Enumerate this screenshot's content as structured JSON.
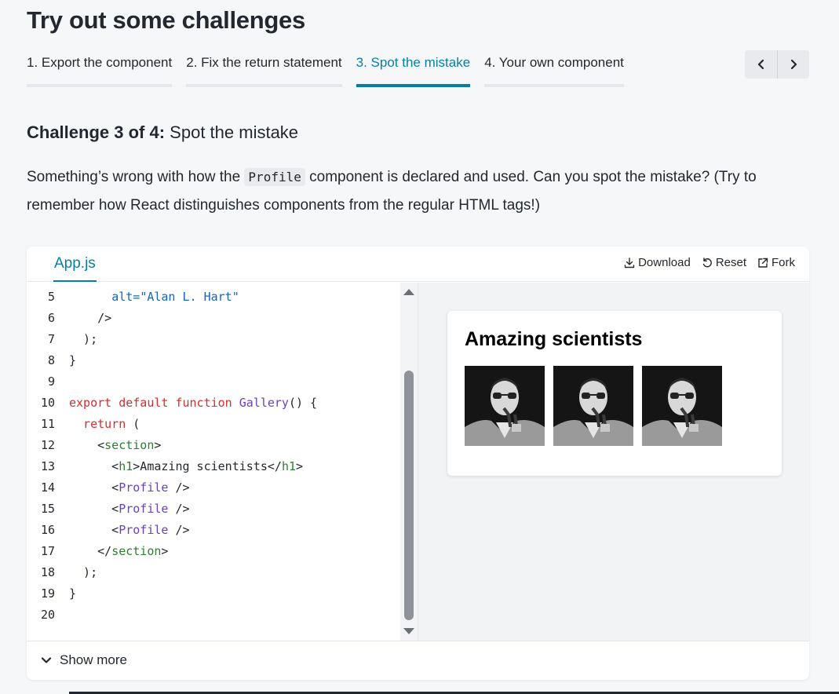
{
  "page": {
    "title": "Try out some challenges"
  },
  "tabs": [
    {
      "label": "1. Export the component",
      "active": false
    },
    {
      "label": "2. Fix the return statement",
      "active": false
    },
    {
      "label": "3. Spot the mistake",
      "active": true
    },
    {
      "label": "4. Your own component",
      "active": false
    }
  ],
  "nav": {
    "prev_icon": "chevron-left-icon",
    "next_icon": "chevron-right-icon"
  },
  "challenge": {
    "counter": "Challenge 3 of 4:",
    "name": "Spot the mistake",
    "desc_before": "Something’s wrong with how the ",
    "desc_code": "Profile",
    "desc_after": " component is declared and used. Can you spot the mistake? (Try to remember how React distinguishes components from the regular HTML tags!)"
  },
  "sandbox": {
    "file_tab": "App.js",
    "actions": {
      "download": "Download",
      "reset": "Reset",
      "fork": "Fork"
    },
    "show_more": "Show more"
  },
  "code_lines": [
    {
      "n": "5",
      "tokens": [
        {
          "t": "      ",
          "c": "plain"
        },
        {
          "t": "alt=",
          "c": "attr"
        },
        {
          "t": "\"Alan L. Hart\"",
          "c": "attr"
        }
      ]
    },
    {
      "n": "6",
      "tokens": [
        {
          "t": "    />",
          "c": "plain"
        }
      ]
    },
    {
      "n": "7",
      "tokens": [
        {
          "t": "  );",
          "c": "plain"
        }
      ]
    },
    {
      "n": "8",
      "tokens": [
        {
          "t": "}",
          "c": "plain"
        }
      ]
    },
    {
      "n": "9",
      "tokens": []
    },
    {
      "n": "10",
      "tokens": [
        {
          "t": "export default function ",
          "c": "kw"
        },
        {
          "t": "Gallery",
          "c": "fn"
        },
        {
          "t": "() {",
          "c": "plain"
        }
      ]
    },
    {
      "n": "11",
      "tokens": [
        {
          "t": "  return ",
          "c": "kw"
        },
        {
          "t": "(",
          "c": "plain"
        }
      ]
    },
    {
      "n": "12",
      "tokens": [
        {
          "t": "    <",
          "c": "plain"
        },
        {
          "t": "section",
          "c": "tag"
        },
        {
          "t": ">",
          "c": "plain"
        }
      ]
    },
    {
      "n": "13",
      "tokens": [
        {
          "t": "      <",
          "c": "plain"
        },
        {
          "t": "h1",
          "c": "tag"
        },
        {
          "t": ">Amazing scientists</",
          "c": "plain"
        },
        {
          "t": "h1",
          "c": "tag"
        },
        {
          "t": ">",
          "c": "plain"
        }
      ]
    },
    {
      "n": "14",
      "tokens": [
        {
          "t": "      <",
          "c": "plain"
        },
        {
          "t": "Profile",
          "c": "comp"
        },
        {
          "t": " />",
          "c": "plain"
        }
      ]
    },
    {
      "n": "15",
      "tokens": [
        {
          "t": "      <",
          "c": "plain"
        },
        {
          "t": "Profile",
          "c": "comp"
        },
        {
          "t": " />",
          "c": "plain"
        }
      ]
    },
    {
      "n": "16",
      "tokens": [
        {
          "t": "      <",
          "c": "plain"
        },
        {
          "t": "Profile",
          "c": "comp"
        },
        {
          "t": " />",
          "c": "plain"
        }
      ]
    },
    {
      "n": "17",
      "tokens": [
        {
          "t": "    </",
          "c": "plain"
        },
        {
          "t": "section",
          "c": "tag"
        },
        {
          "t": ">",
          "c": "plain"
        }
      ]
    },
    {
      "n": "18",
      "tokens": [
        {
          "t": "  );",
          "c": "plain"
        }
      ]
    },
    {
      "n": "19",
      "tokens": [
        {
          "t": "}",
          "c": "plain"
        }
      ]
    },
    {
      "n": "20",
      "tokens": []
    }
  ],
  "preview": {
    "title": "Amazing scientists",
    "portrait_count": 3
  },
  "colors": {
    "accent": "#087ea4",
    "keyword": "#d32f2f",
    "function": "#6a3fbf",
    "tag": "#2e7d32",
    "attribute": "#1565c0"
  }
}
